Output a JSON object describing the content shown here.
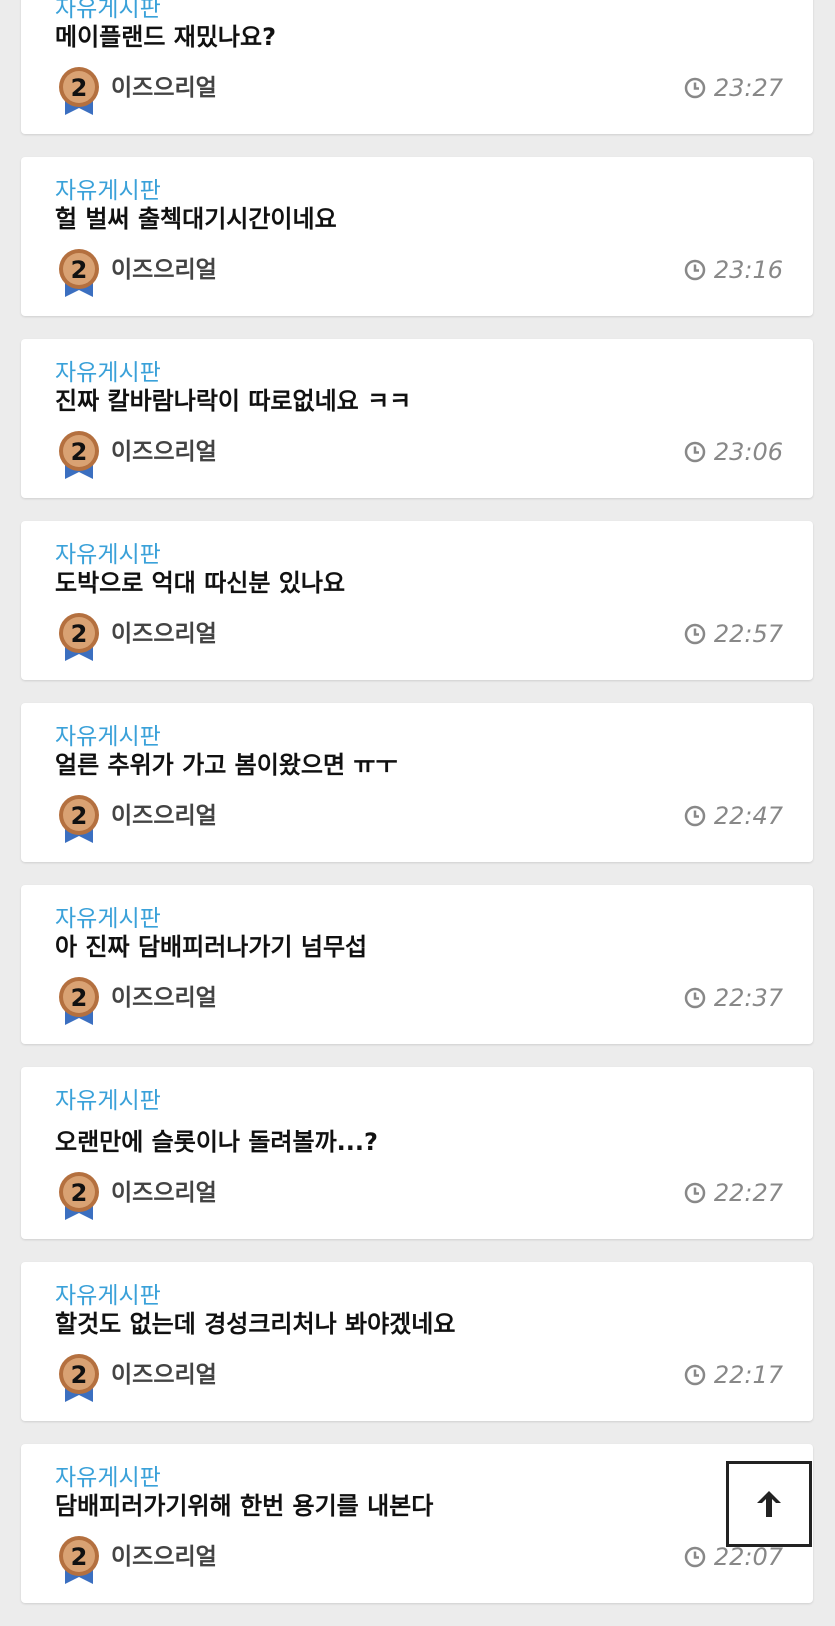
{
  "posts": [
    {
      "board": "자유게시판",
      "title": "메이플랜드 재밌나요?",
      "author": "이즈으리얼",
      "level": "2",
      "time": "23:27"
    },
    {
      "board": "자유게시판",
      "title": "헐 벌써 출첵대기시간이네요",
      "author": "이즈으리얼",
      "level": "2",
      "time": "23:16"
    },
    {
      "board": "자유게시판",
      "title": "진짜 칼바람나락이 따로없네요 ㅋㅋ",
      "author": "이즈으리얼",
      "level": "2",
      "time": "23:06"
    },
    {
      "board": "자유게시판",
      "title": "도박으로 억대 따신분 있나요",
      "author": "이즈으리얼",
      "level": "2",
      "time": "22:57"
    },
    {
      "board": "자유게시판",
      "title": "얼른 추위가 가고 봄이왔으면 ㅠㅜ",
      "author": "이즈으리얼",
      "level": "2",
      "time": "22:47"
    },
    {
      "board": "자유게시판",
      "title": "아 진짜 담배피러나가기 넘무섭",
      "author": "이즈으리얼",
      "level": "2",
      "time": "22:37"
    },
    {
      "board": "자유게시판",
      "title": "오랜만에 슬롯이나 돌려볼까...?",
      "author": "이즈으리얼",
      "level": "2",
      "time": "22:27"
    },
    {
      "board": "자유게시판",
      "title": "할것도 없는데 경성크리처나 봐야겠네요",
      "author": "이즈으리얼",
      "level": "2",
      "time": "22:17"
    },
    {
      "board": "자유게시판",
      "title": "담배피러가기위해 한번 용기를 내본다",
      "author": "이즈으리얼",
      "level": "2",
      "time": "22:07"
    }
  ],
  "colors": {
    "board": "#3aa1d9",
    "title": "#111111",
    "author": "#444444",
    "time": "#888888",
    "background": "#ececec"
  },
  "icons": {
    "clock": "clock-icon",
    "avatar": "level-medal-icon",
    "scroll_top": "arrow-up-icon"
  }
}
